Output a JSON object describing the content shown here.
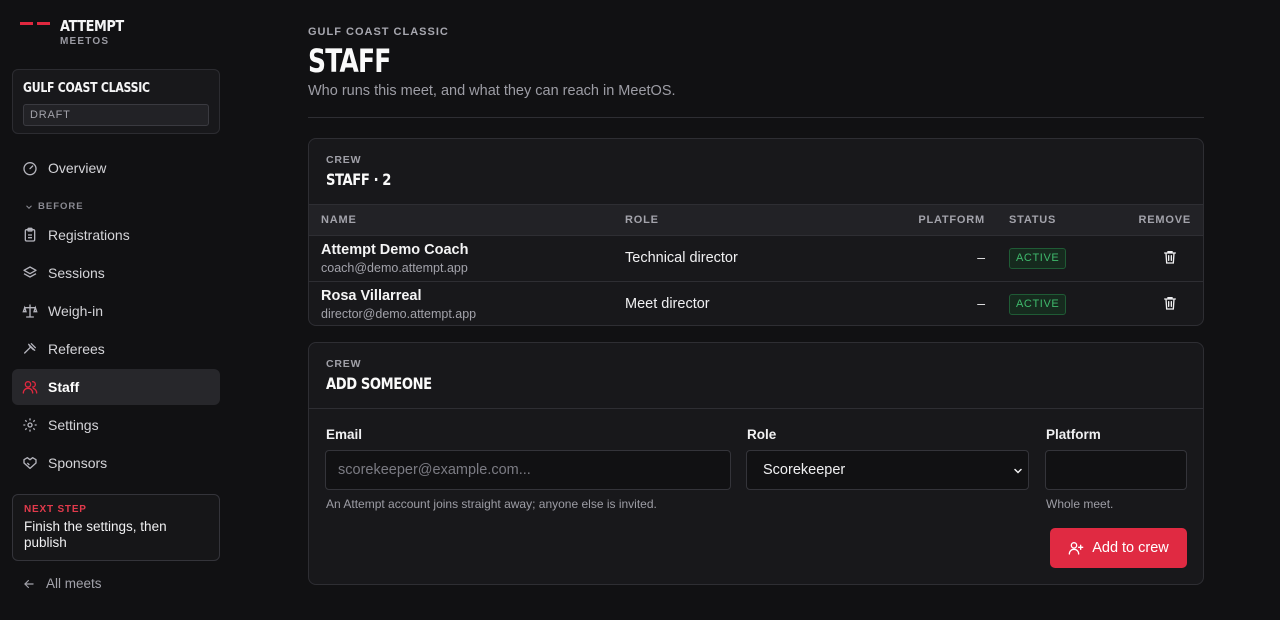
{
  "brand": {
    "name": "ATTEMPT",
    "sub": "MEETOS"
  },
  "meet": {
    "title": "GULF COAST CLASSIC",
    "status": "DRAFT"
  },
  "nav": {
    "overview": "Overview",
    "group_before": "BEFORE",
    "items": [
      {
        "label": "Registrations",
        "icon": "clipboard-icon"
      },
      {
        "label": "Sessions",
        "icon": "layers-icon"
      },
      {
        "label": "Weigh-in",
        "icon": "scale-icon"
      },
      {
        "label": "Referees",
        "icon": "gavel-icon"
      },
      {
        "label": "Staff",
        "icon": "users-icon",
        "active": true
      },
      {
        "label": "Settings",
        "icon": "gear-icon"
      },
      {
        "label": "Sponsors",
        "icon": "handshake-icon"
      }
    ]
  },
  "next_step": {
    "label": "NEXT STEP",
    "text": "Finish the settings, then publish"
  },
  "back": {
    "label": "All meets"
  },
  "header": {
    "eyebrow": "GULF COAST CLASSIC",
    "title": "STAFF",
    "subtitle": "Who runs this meet, and what they can reach in MeetOS."
  },
  "crew": {
    "eyebrow": "CREW",
    "title": "STAFF · 2",
    "columns": {
      "name": "NAME",
      "role": "ROLE",
      "platform": "PLATFORM",
      "status": "STATUS",
      "remove": "REMOVE"
    },
    "rows": [
      {
        "name": "Attempt Demo Coach",
        "email": "coach@demo.attempt.app",
        "role": "Technical director",
        "platform": "–",
        "status": "ACTIVE"
      },
      {
        "name": "Rosa Villarreal",
        "email": "director@demo.attempt.app",
        "role": "Meet director",
        "platform": "–",
        "status": "ACTIVE"
      }
    ]
  },
  "add": {
    "eyebrow": "CREW",
    "title": "ADD SOMEONE",
    "email_label": "Email",
    "email_placeholder": "scorekeeper@example.com...",
    "email_help": "An Attempt account joins straight away; anyone else is invited.",
    "role_label": "Role",
    "role_value": "Scorekeeper",
    "platform_label": "Platform",
    "platform_value": "",
    "platform_help": "Whole meet.",
    "submit_label": "Add to crew"
  },
  "colors": {
    "accent": "#e02a42",
    "active_green": "#3fb96c",
    "background": "#111113",
    "surface": "#18181b"
  }
}
